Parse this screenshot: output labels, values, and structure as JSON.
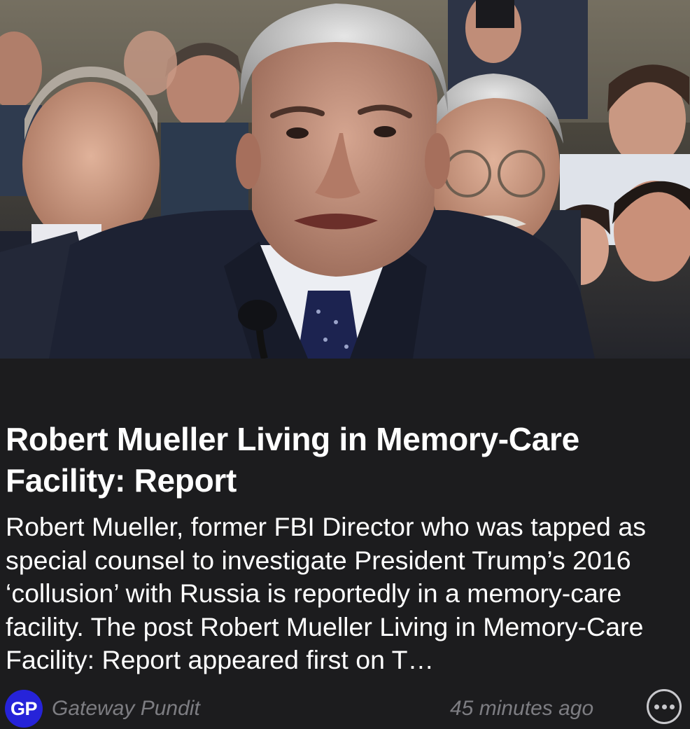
{
  "article": {
    "image_alt": "Robert Mueller testifying at a congressional hearing",
    "headline": "Robert Mueller Living in Memory-Care Facility: Report",
    "summary": "Robert Mueller, former FBI Director who was tapped as special counsel to investigate President Trump’s 2016 ‘collusion’ with Russia is reportedly in a memory-care facility. The post Robert Mueller Living in Memory-Care Facility: Report appeared first on T…"
  },
  "source": {
    "logo_text": "GP",
    "name": "Gateway Pundit",
    "logo_color": "#2623d9"
  },
  "meta": {
    "timestamp": "45 minutes ago"
  },
  "actions": {
    "more_icon": "ellipsis-circle-icon"
  },
  "colors": {
    "background": "#1c1c1e",
    "text_primary": "#ffffff",
    "text_secondary": "#7d7d82"
  }
}
